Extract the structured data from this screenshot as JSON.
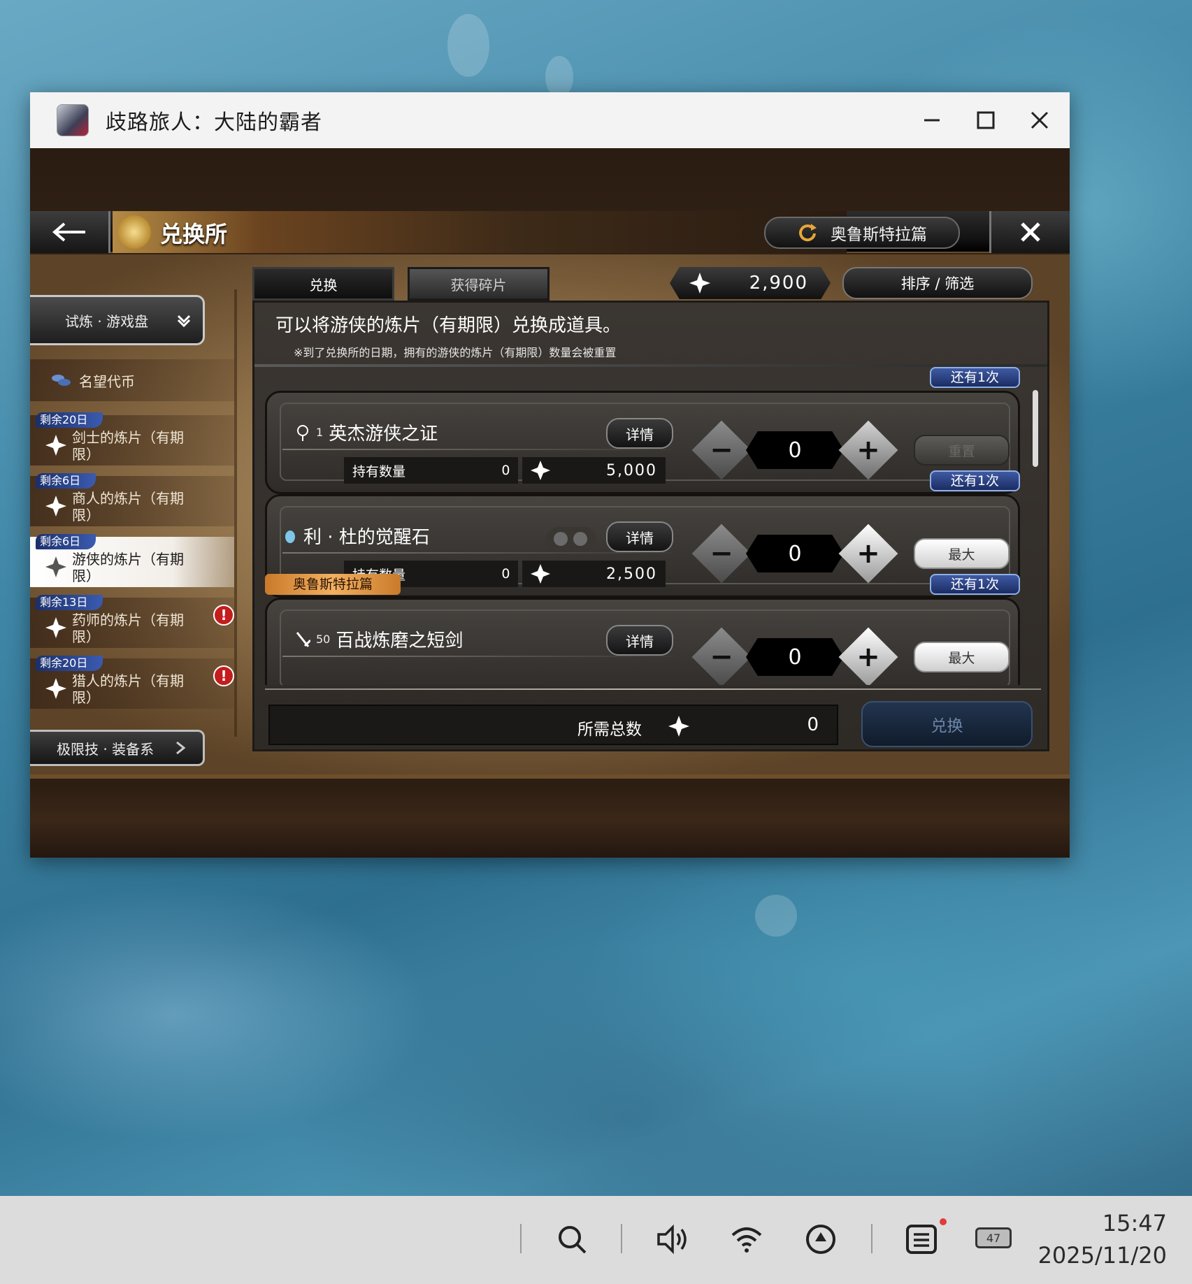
{
  "window": {
    "title": "歧路旅人：大陆的霸者"
  },
  "header": {
    "title": "兑换所",
    "chapter_button": "奥鲁斯特拉篇"
  },
  "sidebar": {
    "category": "试炼 · 游戏盘",
    "fame_label": "名望代币",
    "items": [
      {
        "tag": "剩余20日",
        "label": "剑士的炼片（有期限）",
        "alert": false,
        "active": false
      },
      {
        "tag": "剩余6日",
        "label": "商人的炼片（有期限）",
        "alert": false,
        "active": false
      },
      {
        "tag": "剩余6日",
        "label": "游侠的炼片（有期限）",
        "alert": false,
        "active": true
      },
      {
        "tag": "剩余13日",
        "label": "药师的炼片（有期限）",
        "alert": true,
        "active": false
      },
      {
        "tag": "剩余20日",
        "label": "猎人的炼片（有期限）",
        "alert": true,
        "active": false
      }
    ],
    "bottom_category": "极限技 · 装备系",
    "alert_mark": "!"
  },
  "tabs": {
    "exchange": "兑换",
    "shards": "获得碎片"
  },
  "currency": {
    "amount": "2,900"
  },
  "sort_button": "排序 / 筛选",
  "description": {
    "main": "可以将游侠的炼片（有期限）兑换成道具。",
    "note": "※到了兑换所的日期，拥有的游侠的炼片（有期限）数量会被重置"
  },
  "items": [
    {
      "limit": "还有1次",
      "level": "1",
      "name": "英杰游侠之证",
      "detail": "详情",
      "owned_label": "持有数量",
      "owned": "0",
      "cost": "5,000",
      "qty": "0",
      "action": "重置",
      "action_enabled": false
    },
    {
      "limit": "还有1次",
      "level": "",
      "name": "利 · 杜的觉醒石",
      "detail": "详情",
      "owned_label": "持有数量",
      "owned": "0",
      "cost": "2,500",
      "qty": "0",
      "action": "最大",
      "action_enabled": true
    },
    {
      "chapter_tag": "奥鲁斯特拉篇",
      "limit": "还有1次",
      "level": "50",
      "name": "百战炼磨之短剑",
      "detail": "详情",
      "qty": "0",
      "action": "最大",
      "action_enabled": true
    }
  ],
  "footer": {
    "total_label": "所需总数",
    "total_value": "0",
    "exchange_button": "兑换"
  },
  "taskbar": {
    "time": "15:47",
    "date": "2025/11/20",
    "battery": "47"
  }
}
